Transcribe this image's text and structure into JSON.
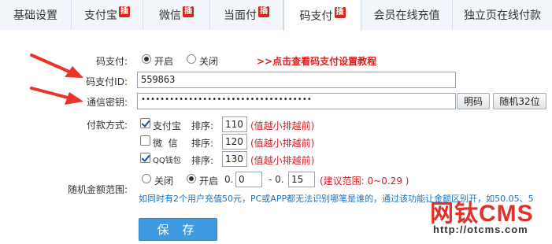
{
  "tabs": [
    {
      "label": "基础设置",
      "badge": ""
    },
    {
      "label": "支付宝",
      "badge": "插"
    },
    {
      "label": "微信",
      "badge": "插"
    },
    {
      "label": "当面付",
      "badge": "插"
    },
    {
      "label": "码支付",
      "badge": "插"
    },
    {
      "label": "会员在线充值",
      "badge": ""
    },
    {
      "label": "独立页在线付款",
      "badge": ""
    }
  ],
  "form": {
    "codepay_label": "码支付:",
    "on_label": "开启",
    "off_label": "关闭",
    "codepay_enabled": true,
    "tutorial_link": ">>点击查看码支付设置教程",
    "id_label": "码支付ID:",
    "id_value": "559863",
    "key_label": "通信密钥:",
    "key_value": "••••••••••••••••••••••••••••••••••••",
    "plaintext_button": "明码",
    "random_button": "随机32位",
    "paymethod_label": "付款方式:",
    "sort_label": "排序:",
    "sort_hint": "(值越小排越前)",
    "methods": [
      {
        "name": "支付宝",
        "checked": true,
        "sort": "110"
      },
      {
        "name": "微  信",
        "checked": false,
        "sort": "120"
      },
      {
        "name": "QQ钱包",
        "checked": true,
        "sort": "130"
      }
    ],
    "random_label": "随机金额范围:",
    "random_off": "关闭",
    "random_on": "开启",
    "random_enabled": true,
    "range_prefix_from": "0.",
    "range_from": "0",
    "range_sep": "- 0.",
    "range_to": "15",
    "range_hint": "(建议范围: 0~0.29 )",
    "range_tip": "如同时有2个用户充值50元，PC或APP都无法识别哪笔是谁的，通过该功能让金额区别开，如50.05、5",
    "save_button": "保 存"
  },
  "watermark": {
    "title": "网钛CMS",
    "url": "http://otcms.com"
  },
  "colors": {
    "accent": "#3e9ae1",
    "hint_red": "#d0202a",
    "badge_red": "#d9261c",
    "tip_blue": "#1e73be"
  }
}
